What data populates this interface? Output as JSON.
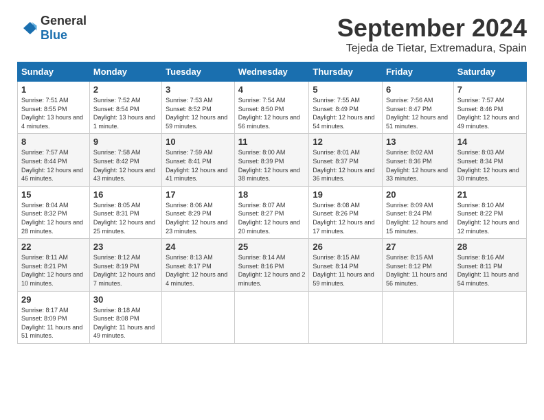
{
  "header": {
    "logo_general": "General",
    "logo_blue": "Blue",
    "month_title": "September 2024",
    "location": "Tejeda de Tietar, Extremadura, Spain"
  },
  "weekdays": [
    "Sunday",
    "Monday",
    "Tuesday",
    "Wednesday",
    "Thursday",
    "Friday",
    "Saturday"
  ],
  "weeks": [
    [
      {
        "day": "1",
        "sunrise": "7:51 AM",
        "sunset": "8:55 PM",
        "daylight": "13 hours and 4 minutes."
      },
      {
        "day": "2",
        "sunrise": "7:52 AM",
        "sunset": "8:54 PM",
        "daylight": "13 hours and 1 minute."
      },
      {
        "day": "3",
        "sunrise": "7:53 AM",
        "sunset": "8:52 PM",
        "daylight": "12 hours and 59 minutes."
      },
      {
        "day": "4",
        "sunrise": "7:54 AM",
        "sunset": "8:50 PM",
        "daylight": "12 hours and 56 minutes."
      },
      {
        "day": "5",
        "sunrise": "7:55 AM",
        "sunset": "8:49 PM",
        "daylight": "12 hours and 54 minutes."
      },
      {
        "day": "6",
        "sunrise": "7:56 AM",
        "sunset": "8:47 PM",
        "daylight": "12 hours and 51 minutes."
      },
      {
        "day": "7",
        "sunrise": "7:57 AM",
        "sunset": "8:46 PM",
        "daylight": "12 hours and 49 minutes."
      }
    ],
    [
      {
        "day": "8",
        "sunrise": "7:57 AM",
        "sunset": "8:44 PM",
        "daylight": "12 hours and 46 minutes."
      },
      {
        "day": "9",
        "sunrise": "7:58 AM",
        "sunset": "8:42 PM",
        "daylight": "12 hours and 43 minutes."
      },
      {
        "day": "10",
        "sunrise": "7:59 AM",
        "sunset": "8:41 PM",
        "daylight": "12 hours and 41 minutes."
      },
      {
        "day": "11",
        "sunrise": "8:00 AM",
        "sunset": "8:39 PM",
        "daylight": "12 hours and 38 minutes."
      },
      {
        "day": "12",
        "sunrise": "8:01 AM",
        "sunset": "8:37 PM",
        "daylight": "12 hours and 36 minutes."
      },
      {
        "day": "13",
        "sunrise": "8:02 AM",
        "sunset": "8:36 PM",
        "daylight": "12 hours and 33 minutes."
      },
      {
        "day": "14",
        "sunrise": "8:03 AM",
        "sunset": "8:34 PM",
        "daylight": "12 hours and 30 minutes."
      }
    ],
    [
      {
        "day": "15",
        "sunrise": "8:04 AM",
        "sunset": "8:32 PM",
        "daylight": "12 hours and 28 minutes."
      },
      {
        "day": "16",
        "sunrise": "8:05 AM",
        "sunset": "8:31 PM",
        "daylight": "12 hours and 25 minutes."
      },
      {
        "day": "17",
        "sunrise": "8:06 AM",
        "sunset": "8:29 PM",
        "daylight": "12 hours and 23 minutes."
      },
      {
        "day": "18",
        "sunrise": "8:07 AM",
        "sunset": "8:27 PM",
        "daylight": "12 hours and 20 minutes."
      },
      {
        "day": "19",
        "sunrise": "8:08 AM",
        "sunset": "8:26 PM",
        "daylight": "12 hours and 17 minutes."
      },
      {
        "day": "20",
        "sunrise": "8:09 AM",
        "sunset": "8:24 PM",
        "daylight": "12 hours and 15 minutes."
      },
      {
        "day": "21",
        "sunrise": "8:10 AM",
        "sunset": "8:22 PM",
        "daylight": "12 hours and 12 minutes."
      }
    ],
    [
      {
        "day": "22",
        "sunrise": "8:11 AM",
        "sunset": "8:21 PM",
        "daylight": "12 hours and 10 minutes."
      },
      {
        "day": "23",
        "sunrise": "8:12 AM",
        "sunset": "8:19 PM",
        "daylight": "12 hours and 7 minutes."
      },
      {
        "day": "24",
        "sunrise": "8:13 AM",
        "sunset": "8:17 PM",
        "daylight": "12 hours and 4 minutes."
      },
      {
        "day": "25",
        "sunrise": "8:14 AM",
        "sunset": "8:16 PM",
        "daylight": "12 hours and 2 minutes."
      },
      {
        "day": "26",
        "sunrise": "8:15 AM",
        "sunset": "8:14 PM",
        "daylight": "11 hours and 59 minutes."
      },
      {
        "day": "27",
        "sunrise": "8:15 AM",
        "sunset": "8:12 PM",
        "daylight": "11 hours and 56 minutes."
      },
      {
        "day": "28",
        "sunrise": "8:16 AM",
        "sunset": "8:11 PM",
        "daylight": "11 hours and 54 minutes."
      }
    ],
    [
      {
        "day": "29",
        "sunrise": "8:17 AM",
        "sunset": "8:09 PM",
        "daylight": "11 hours and 51 minutes."
      },
      {
        "day": "30",
        "sunrise": "8:18 AM",
        "sunset": "8:08 PM",
        "daylight": "11 hours and 49 minutes."
      },
      null,
      null,
      null,
      null,
      null
    ]
  ]
}
